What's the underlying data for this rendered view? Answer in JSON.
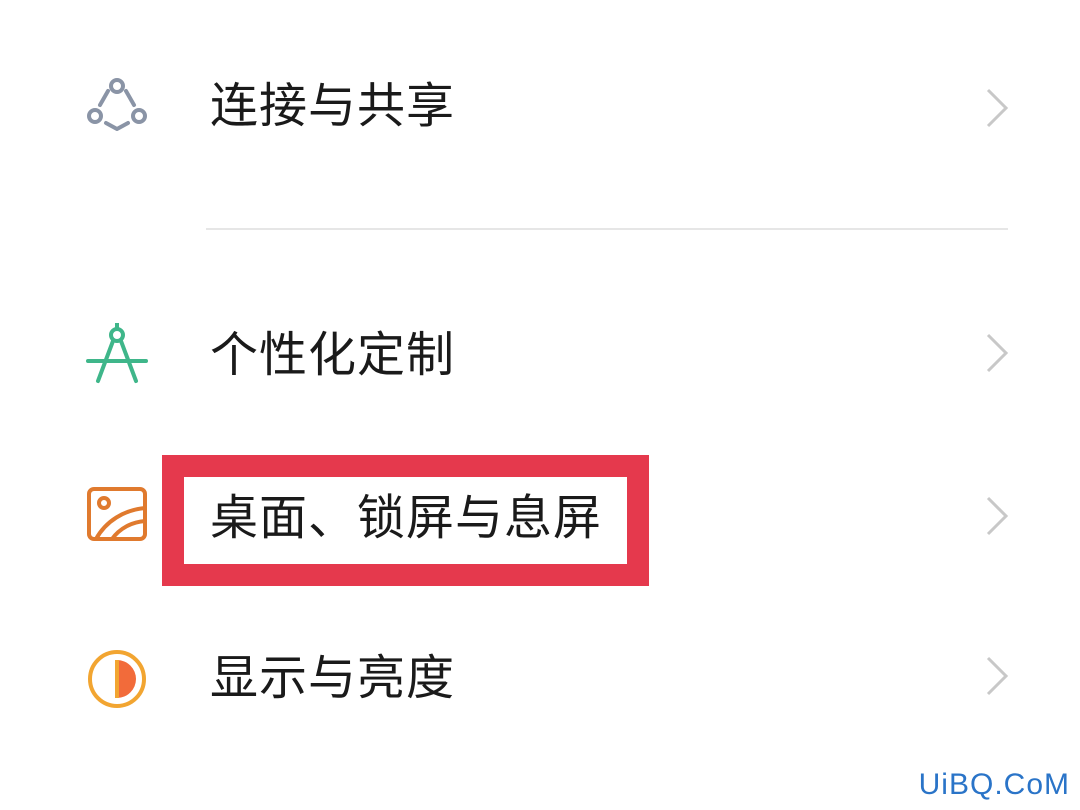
{
  "settings": {
    "items": [
      {
        "label": "连接与共享",
        "icon": "share-connect-icon",
        "icon_color": "#8a94a6"
      },
      {
        "label": "个性化定制",
        "icon": "compass-icon",
        "icon_color": "#3fb68a"
      },
      {
        "label": "桌面、锁屏与息屏",
        "icon": "wallpaper-icon",
        "icon_color": "#e07a2e"
      },
      {
        "label": "显示与亮度",
        "icon": "brightness-icon",
        "icon_color": "#f2a531"
      }
    ]
  },
  "highlight_color": "#e5394d",
  "watermark": "UiBQ.CoM"
}
